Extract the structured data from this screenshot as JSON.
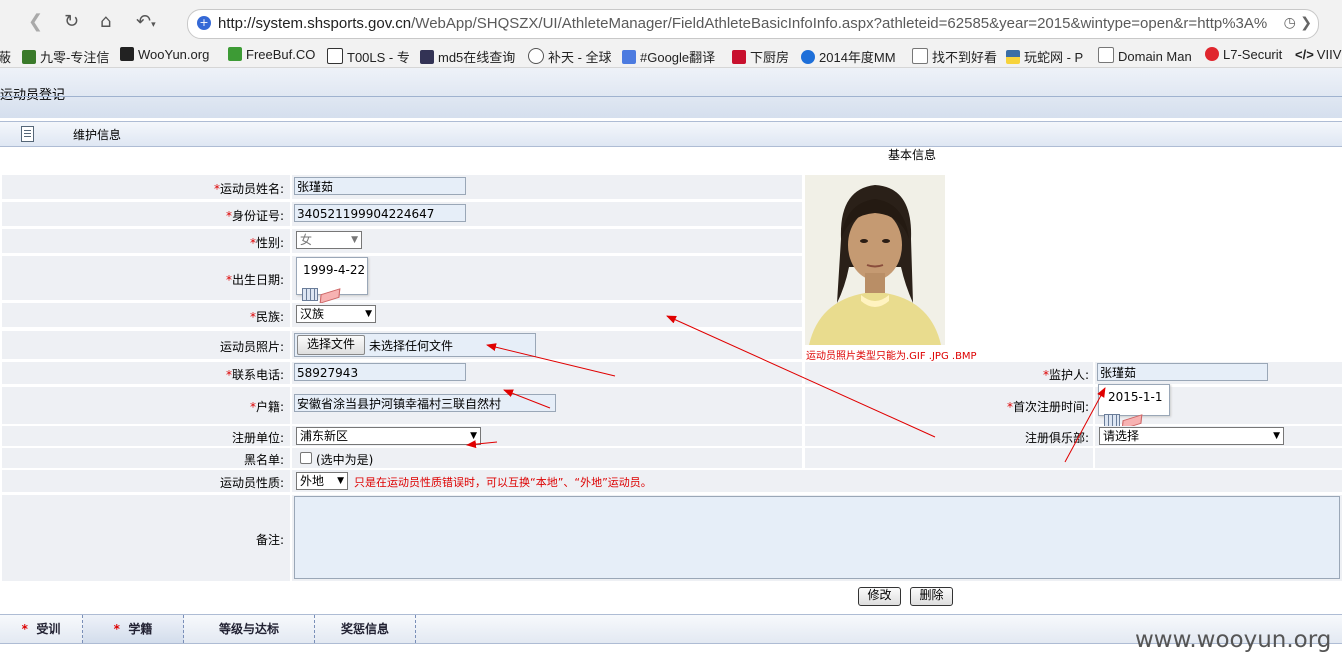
{
  "browser": {
    "url_prefix": "http://system.shsports.gov.cn",
    "url_rest": "/WebApp/SHQSZX/UI/AthleteManager/FieldAthleteBasicInfoInfo.aspx?athleteid=62585&year=2015&wintype=open&r=http%3A%",
    "bookmarks": [
      "蔽",
      "九零-专注信",
      "WooYun.org",
      "FreeBuf.CO",
      "T00LS - 专",
      "md5在线查询",
      "补天 - 全球",
      "#Google翻译",
      "下厨房",
      "2014年度MM",
      "找不到好看",
      "玩蛇网 - P",
      "Domain Man",
      "L7-Securit",
      "VIIV"
    ]
  },
  "page": {
    "title": "运动员登记",
    "section_label": "维护信息",
    "basic_info_heading": "基本信息"
  },
  "form": {
    "name": {
      "label": "运动员姓名:",
      "value": "张瑾茹"
    },
    "id_number": {
      "label": "身份证号:",
      "value": "340521199904224647"
    },
    "gender": {
      "label": "性别:",
      "value": "女"
    },
    "birth_date": {
      "label": "出生日期:",
      "value": "1999-4-22"
    },
    "ethnicity": {
      "label": "民族:",
      "value": "汉族"
    },
    "photo": {
      "label": "运动员照片:",
      "button": "选择文件",
      "status": "未选择任何文件",
      "hint": "运动员照片类型只能为.GIF .JPG .BMP"
    },
    "phone": {
      "label": "联系电话:",
      "value": "58927943"
    },
    "guardian": {
      "label": "监护人:",
      "value": "张瑾茹"
    },
    "household": {
      "label": "户籍:",
      "value": "安徽省涂当县护河镇幸福村三联自然村"
    },
    "first_reg_date": {
      "label": "首次注册时间:",
      "value": "2015-1-1"
    },
    "reg_unit": {
      "label": "注册单位:",
      "value": "浦东新区"
    },
    "reg_club": {
      "label": "注册俱乐部:",
      "value": "请选择"
    },
    "blacklist": {
      "label": "黑名单:",
      "checkbox_text": "(选中为是)"
    },
    "athlete_type": {
      "label": "运动员性质:",
      "value": "外地",
      "note": "只是在运动员性质错误时，可以互换“本地”、“外地”运动员。"
    },
    "remarks": {
      "label": "备注:"
    },
    "required_mark": "*"
  },
  "buttons": {
    "modify": "修改",
    "delete": "删除"
  },
  "tabs": [
    {
      "label": "受训",
      "required": true
    },
    {
      "label": "学籍",
      "required": true
    },
    {
      "label": "等级与达标",
      "required": false
    },
    {
      "label": "奖惩信息",
      "required": false
    }
  ],
  "watermark": "www.wooyun.org",
  "colors": {
    "required": "#dd0000",
    "annotation_arrow": "#e00000",
    "input_bg": "#e6eef8",
    "row_bg": "#eef0f4"
  }
}
